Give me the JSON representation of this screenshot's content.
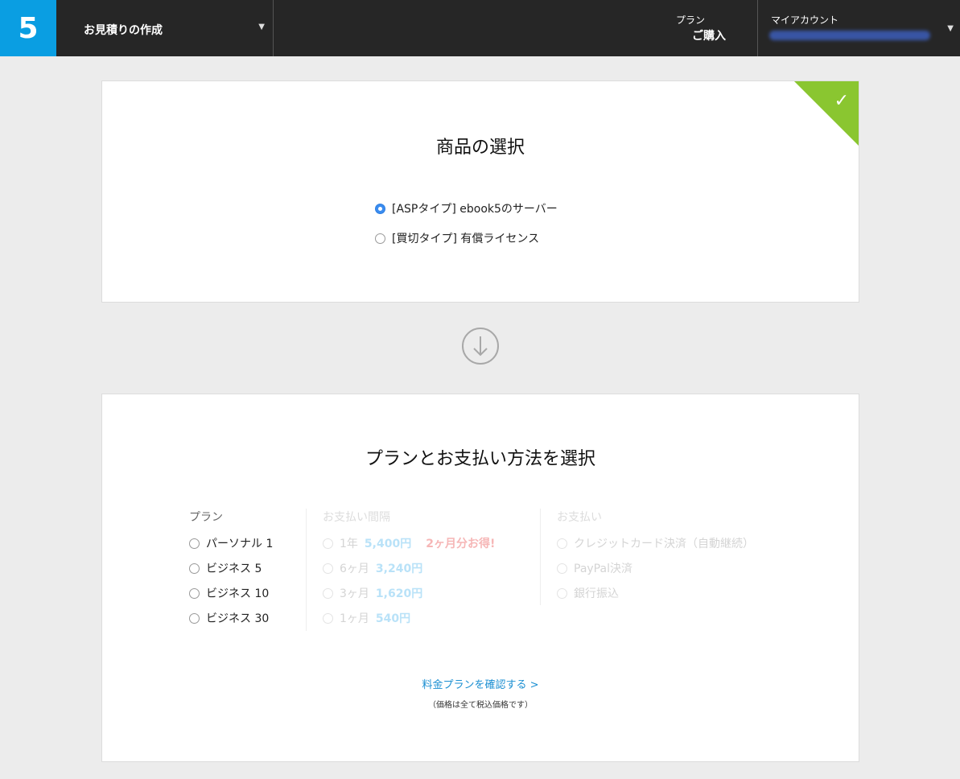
{
  "header": {
    "logo": "5",
    "menu_title": "お見積りの作成",
    "plan_label": "プラン",
    "plan_action": "ご購入",
    "account_label": "マイアカウント",
    "accent_color": "#0a9ee2"
  },
  "product_card": {
    "title": "商品の選択",
    "options": [
      {
        "label": "[ASPタイプ] ebook5のサーバー",
        "selected": true
      },
      {
        "label": "[買切タイプ] 有償ライセンス",
        "selected": false
      }
    ],
    "completed_color": "#8ac630"
  },
  "plan_card": {
    "title": "プランとお支払い方法を選択",
    "plan_heading": "プラン",
    "plans": [
      "パーソナル 1",
      "ビジネス 5",
      "ビジネス 10",
      "ビジネス 30"
    ],
    "interval_heading": "お支払い間隔",
    "intervals": [
      {
        "period": "1年",
        "price": "5,400円",
        "deal": "2ヶ月分お得!"
      },
      {
        "period": "6ヶ月",
        "price": "3,240円"
      },
      {
        "period": "3ヶ月",
        "price": "1,620円"
      },
      {
        "period": "1ヶ月",
        "price": "540円"
      }
    ],
    "payment_heading": "お支払い",
    "payments": [
      "クレジットカード決済（自動継続）",
      "PayPal決済",
      "銀行振込"
    ],
    "link": "料金プランを確認する >",
    "note": "（価格は全て税込価格です）"
  }
}
